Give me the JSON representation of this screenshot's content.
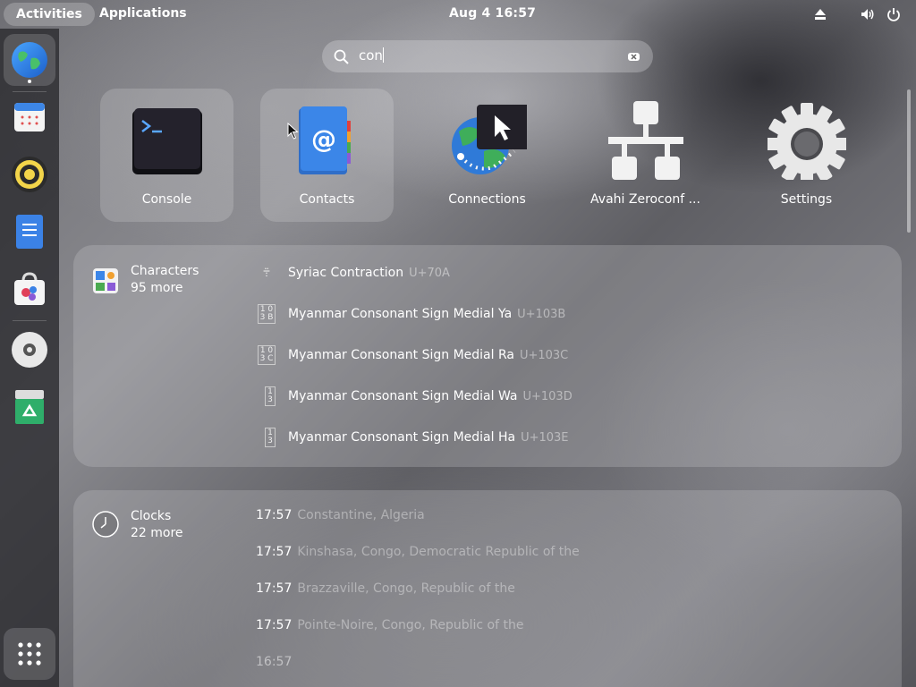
{
  "topbar": {
    "activities": "Activities",
    "applications": "Applications",
    "datetime": "Aug 4  16:57",
    "tray": [
      {
        "name": "eject-icon"
      },
      {
        "name": "volume-icon"
      },
      {
        "name": "power-icon"
      }
    ]
  },
  "dash": {
    "items": [
      {
        "name": "web-browser",
        "icon": "globe-icon",
        "running": true
      },
      {
        "name": "calendar",
        "icon": "calendar-icon"
      },
      {
        "name": "rhythmbox",
        "icon": "speaker-icon"
      },
      {
        "name": "text-editor",
        "icon": "document-icon"
      },
      {
        "name": "software",
        "icon": "shopping-bag-icon"
      },
      {
        "name": "disc",
        "icon": "disc-icon"
      },
      {
        "name": "trash",
        "icon": "recycle-icon"
      }
    ],
    "show_apps": "grid-icon"
  },
  "search": {
    "value": "con",
    "icon": "search-icon",
    "clear_icon": "clear-icon"
  },
  "apps": [
    {
      "label": "Console",
      "icon": "terminal-icon",
      "selected": true
    },
    {
      "label": "Contacts",
      "icon": "contacts-icon",
      "selected": true
    },
    {
      "label": "Connections",
      "icon": "connections-icon"
    },
    {
      "label": "Avahi Zeroconf ...",
      "icon": "network-icon"
    },
    {
      "label": "Settings",
      "icon": "gear-icon"
    }
  ],
  "characters": {
    "provider": "Characters",
    "more": "95 more",
    "rows": [
      {
        "glyph": "܊",
        "name": "Syriac Contraction",
        "code": "U+70A"
      },
      {
        "glyph": "1 0\n3 B",
        "name": "Myanmar Consonant Sign Medial Ya",
        "code": "U+103B"
      },
      {
        "glyph": "1 0\n3 C",
        "name": "Myanmar Consonant Sign Medial Ra",
        "code": "U+103C"
      },
      {
        "glyph": "1\n3",
        "name": "Myanmar Consonant Sign Medial Wa",
        "code": "U+103D"
      },
      {
        "glyph": "1\n3",
        "name": "Myanmar Consonant Sign Medial Ha",
        "code": "U+103E"
      }
    ]
  },
  "clocks": {
    "provider": "Clocks",
    "more": "22 more",
    "rows": [
      {
        "time": "17:57",
        "place": "Constantine, Algeria"
      },
      {
        "time": "17:57",
        "place": "Kinshasa, Congo, Democratic Republic of the"
      },
      {
        "time": "17:57",
        "place": "Brazzaville, Congo, Republic of the"
      },
      {
        "time": "17:57",
        "place": "Pointe-Noire, Congo, Republic of the"
      },
      {
        "time": "16:57",
        "place": ""
      }
    ]
  }
}
